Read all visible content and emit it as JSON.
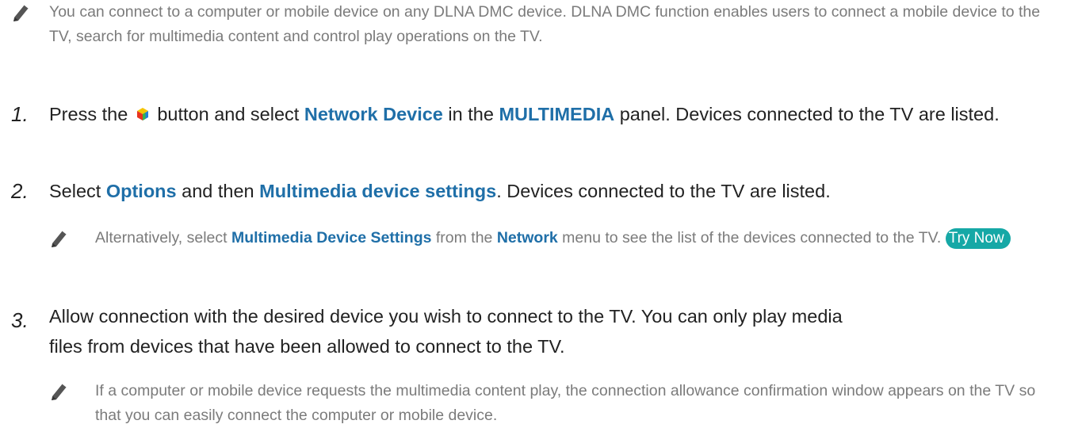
{
  "notes": {
    "intro": "You can connect to a computer or mobile device on any DLNA DMC device. DLNA DMC function enables users to connect a mobile device to the TV, search for multimedia content and control play operations on the TV.",
    "alt_prefix": "Alternatively, select ",
    "alt_hl1": "Multimedia Device Settings",
    "alt_mid": " from the ",
    "alt_hl2": "Network",
    "alt_suffix": " menu to see the list of the devices connected to the TV.",
    "try_now": "Try Now",
    "request": "If a computer or mobile device requests the multimedia content play, the connection allowance confirmation window appears on the TV so that you can easily connect the computer or mobile device."
  },
  "steps": [
    {
      "num": "1.",
      "pre": "Press the ",
      "mid": " button and select ",
      "hl1": "Network Device",
      "mid2": " in the ",
      "hl2": "MULTIMEDIA",
      "post": " panel. Devices connected to the TV are listed.",
      "icon": "smart-hub-cube-icon"
    },
    {
      "num": "2.",
      "pre": "Select ",
      "hl1": "Options",
      "mid": " and then ",
      "hl2": "Multimedia device settings",
      "post": ". Devices connected to the TV are listed."
    },
    {
      "num": "3.",
      "text": "Allow connection with the desired device you wish to connect to the TV. You can only play media files from devices that have been allowed to connect to the TV."
    }
  ],
  "colors": {
    "highlight": "#1f6fa8",
    "note_text": "#7b7b7b",
    "try_now_bg": "#16a8a6"
  }
}
